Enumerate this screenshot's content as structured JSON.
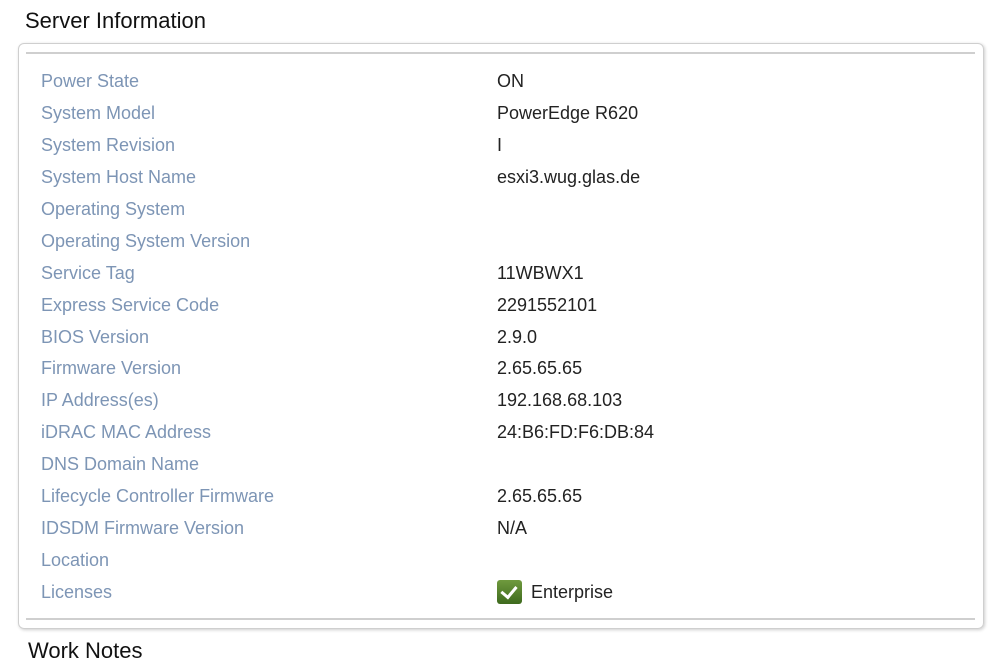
{
  "title": "Server Information",
  "rows": [
    {
      "label": "Power State",
      "value": "ON"
    },
    {
      "label": "System Model",
      "value": "PowerEdge R620"
    },
    {
      "label": "System Revision",
      "value": "I"
    },
    {
      "label": "System Host Name",
      "value": "esxi3.wug.glas.de"
    },
    {
      "label": "Operating System",
      "value": ""
    },
    {
      "label": "Operating System Version",
      "value": ""
    },
    {
      "label": "Service Tag",
      "value": "11WBWX1"
    },
    {
      "label": "Express Service Code",
      "value": "2291552101"
    },
    {
      "label": "BIOS Version",
      "value": "2.9.0"
    },
    {
      "label": "Firmware Version",
      "value": "2.65.65.65"
    },
    {
      "label": "IP Address(es)",
      "value": "192.168.68.103"
    },
    {
      "label": "iDRAC MAC Address",
      "value": "24:B6:FD:F6:DB:84"
    },
    {
      "label": "DNS Domain Name",
      "value": ""
    },
    {
      "label": "Lifecycle Controller Firmware",
      "value": "2.65.65.65"
    },
    {
      "label": "IDSDM Firmware Version",
      "value": "N/A"
    },
    {
      "label": "Location",
      "value": ""
    },
    {
      "label": "Licenses",
      "value": "Enterprise",
      "icon": "checkmark-icon"
    }
  ],
  "next_section": "Work Notes"
}
